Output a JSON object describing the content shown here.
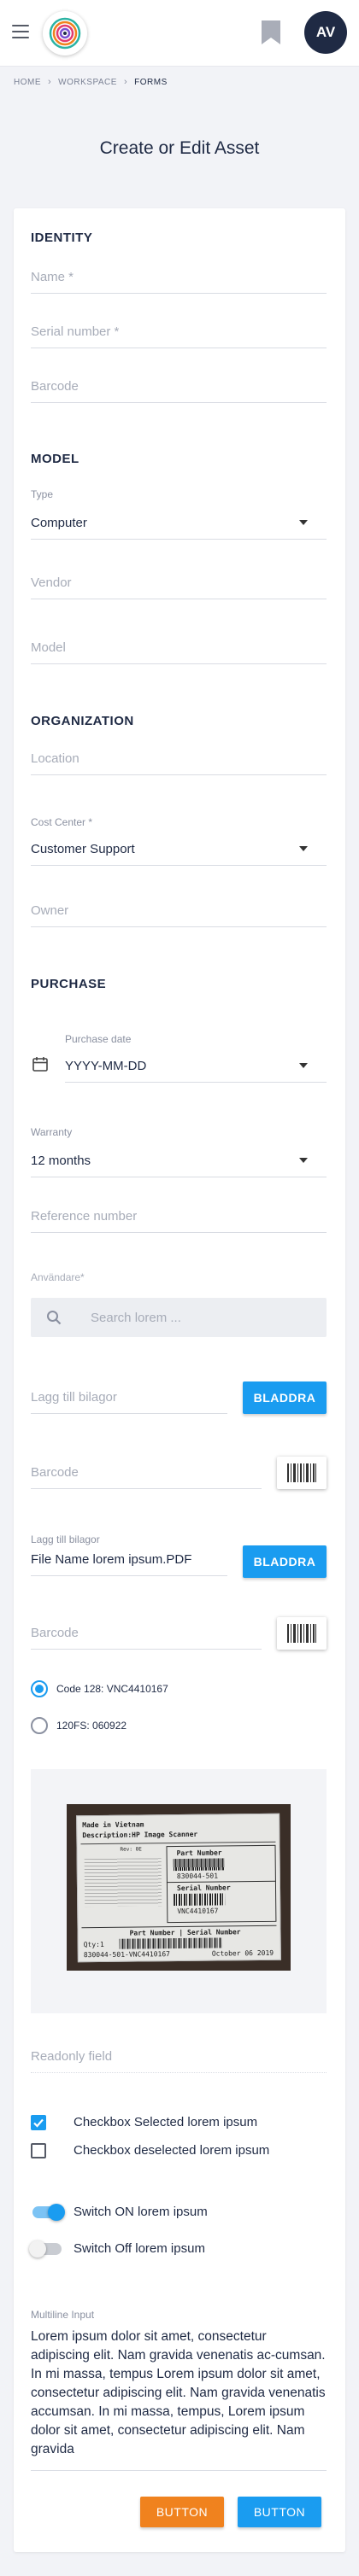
{
  "header": {
    "menu_icon": "hamburger-icon",
    "logo_icon": "mandala-logo",
    "bookmark_icon": "bookmark-icon",
    "avatar_initials": "AV",
    "colors": {
      "avatar_bg": "#1f2a44",
      "accent": "#1a9cf0",
      "orange": "#f0821e"
    }
  },
  "breadcrumb": {
    "items": [
      "HOME",
      "WORKSPACE",
      "FORMS"
    ]
  },
  "page": {
    "title": "Create or Edit Asset"
  },
  "identity": {
    "heading": "IDENTITY",
    "name_placeholder": "Name *",
    "serial_placeholder": "Serial number *",
    "barcode_placeholder": "Barcode"
  },
  "model": {
    "heading": "MODEL",
    "type_label": "Type",
    "type_value": "Computer",
    "vendor_placeholder": "Vendor",
    "model_placeholder": "Model"
  },
  "organization": {
    "heading": "ORGANIZATION",
    "location_placeholder": "Location",
    "cost_center_label": "Cost Center *",
    "cost_center_value": "Customer Support",
    "owner_placeholder": "Owner"
  },
  "purchase": {
    "heading": "PURCHASE",
    "date_label": "Purchase date",
    "date_value": "YYYY-MM-DD",
    "warranty_label": "Warranty",
    "warranty_value": "12 months",
    "reference_placeholder": "Reference number"
  },
  "anvandare": {
    "label": "Användare*",
    "search_placeholder": "Search lorem ..."
  },
  "attachments": {
    "add_placeholder": "Lagg till bilagor",
    "browse_label": "BLADDRA",
    "barcode_placeholder": "Barcode",
    "file_label": "Lagg till bilagor",
    "file_value": "File Name lorem ipsum.PDF",
    "browse_label_2": "BLADDRA",
    "barcode2_placeholder": "Barcode"
  },
  "barcode_options": [
    {
      "label": "Code 128: VNC4410167",
      "selected": true
    },
    {
      "label": "120FS: 060922",
      "selected": false
    }
  ],
  "photo": {
    "made_in": "Made in Vietnam",
    "description": "Description:HP Image Scanner",
    "rev": "Rev: 0E",
    "part_number_title": "Part Number",
    "part_number": "830044-501",
    "serial_title": "Serial Number",
    "serial": "VNC4410167",
    "bottom_title": "Part Number | Serial Number",
    "qty": "Qty:1",
    "bottom_code": "830044-501-VNC4410167",
    "date": "October 06 2019"
  },
  "readonly": {
    "placeholder": "Readonly field"
  },
  "checkboxes": [
    {
      "label": "Checkbox Selected lorem ipsum",
      "checked": true
    },
    {
      "label": "Checkbox deselected lorem ipsum",
      "checked": false
    }
  ],
  "switches": [
    {
      "label": "Switch ON lorem ipsum",
      "on": true
    },
    {
      "label": "Switch Off lorem ipsum",
      "on": false
    }
  ],
  "multiline": {
    "label": "Multiline Input",
    "text": "Lorem ipsum dolor sit amet, consectetur adipiscing elit. Nam gravida venenatis ac-cumsan. In mi massa, tempus Lorem ipsum dolor sit amet, consectetur adipiscing elit. Nam gravida venenatis accumsan. In mi massa, tempus, Lorem ipsum dolor sit amet, consectetur adipiscing elit. Nam gravida"
  },
  "actions": {
    "orange_label": "BUTTON",
    "blue_label": "BUTTON"
  }
}
